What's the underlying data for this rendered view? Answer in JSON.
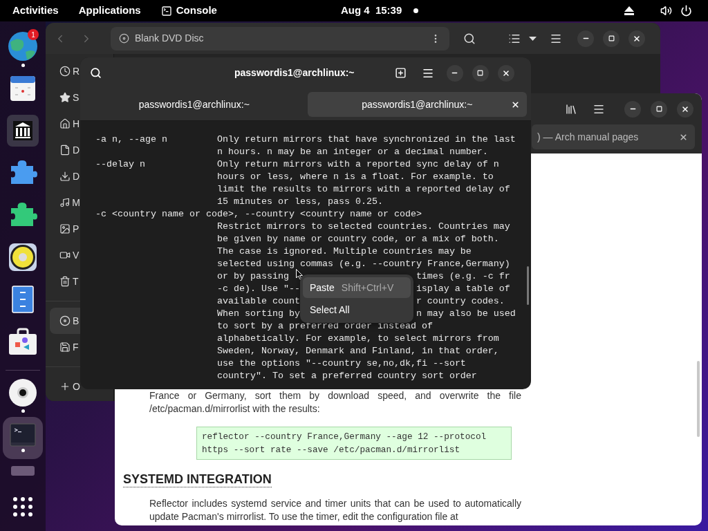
{
  "top_bar": {
    "activities": "Activities",
    "applications": "Applications",
    "app_menu": "Console",
    "clock": "Aug 4  15:39"
  },
  "dock": {
    "items": [
      {
        "kind": "browser",
        "running": true,
        "selected": false,
        "badge": "1"
      },
      {
        "kind": "calendar",
        "running": false,
        "selected": false
      },
      {
        "kind": "library",
        "running": false,
        "selected": false
      },
      {
        "kind": "puzzle-blue",
        "running": false,
        "selected": false
      },
      {
        "kind": "puzzle-green",
        "running": false,
        "selected": false
      },
      {
        "kind": "speaker",
        "running": false,
        "selected": false
      },
      {
        "kind": "cabinet",
        "running": false,
        "selected": false
      },
      {
        "kind": "store",
        "running": false,
        "selected": false
      },
      {
        "kind": "separator"
      },
      {
        "kind": "disc",
        "running": true,
        "selected": false
      },
      {
        "kind": "terminal",
        "running": true,
        "selected": true
      },
      {
        "kind": "bar",
        "running": false,
        "selected": false
      },
      {
        "kind": "grid",
        "running": false,
        "selected": false
      }
    ]
  },
  "files_window": {
    "location": "Blank DVD Disc",
    "sidebar": [
      {
        "kind": "recent",
        "label": "R",
        "selected": false
      },
      {
        "kind": "starred",
        "label": "S",
        "selected": false
      },
      {
        "kind": "home",
        "label": "H",
        "selected": false
      },
      {
        "kind": "documents",
        "label": "D",
        "selected": false
      },
      {
        "kind": "downloads",
        "label": "D",
        "selected": false
      },
      {
        "kind": "music",
        "label": "M",
        "selected": false
      },
      {
        "kind": "pictures",
        "label": "P",
        "selected": false
      },
      {
        "kind": "videos",
        "label": "V",
        "selected": false
      },
      {
        "kind": "trash",
        "label": "T",
        "selected": false
      },
      {
        "kind": "separator"
      },
      {
        "kind": "disc",
        "label": "B",
        "selected": true
      },
      {
        "kind": "floppy",
        "label": "F",
        "selected": false
      },
      {
        "kind": "separator"
      },
      {
        "kind": "other",
        "label": "O",
        "selected": false
      }
    ]
  },
  "browser_window": {
    "tab_title": ") — Arch manual pages",
    "paragraph_1": "France or Germany, sort them by download speed, and overwrite the file /etc/pacman.d/mirrorlist with the results:",
    "code": [
      "reflector --country France,Germany --age 12 --protocol",
      "https --sort rate --save /etc/pacman.d/mirrorlist"
    ],
    "heading": "SYSTEMD INTEGRATION",
    "paragraph_2": "Reflector includes systemd service and timer units that can be used to automatically update Pacman's mirrorlist. To use the timer, edit the configuration file at"
  },
  "terminal_window": {
    "title": "passwordis1@archlinux:~",
    "tabs": [
      {
        "label": "passwordis1@archlinux:~",
        "selected": false
      },
      {
        "label": "passwordis1@archlinux:~",
        "selected": true
      }
    ],
    "rows": [
      {
        "option": "-a n, --age n",
        "text": [
          "Only return mirrors that have synchronized in the last"
        ]
      },
      {
        "text": [
          "n hours. n may be an integer or a decimal number."
        ]
      },
      {
        "option": "--delay n",
        "text": [
          "Only return mirrors with a reported sync delay of n"
        ]
      },
      {
        "text": [
          "hours or less, where n is a float. For example. to"
        ]
      },
      {
        "text": [
          "limit the results to mirrors with a reported delay of"
        ]
      },
      {
        "text": [
          "15 minutes or less, pass 0.25."
        ]
      },
      {
        "option": "-c <country name or code>, --country <country name or code>",
        "text": []
      },
      {
        "text": [
          "Restrict mirrors to selected countries. Countries may"
        ]
      },
      {
        "text": [
          "be given by name or country code, or a mix of both."
        ]
      },
      {
        "text": [
          "The case is ignored. Multiple countries may be"
        ]
      },
      {
        "text": [
          "selected using commas (e.g. --country France,Germany)"
        ]
      },
      {
        "text": [
          "or by passing",
          "times (e.g. -c fr"
        ]
      },
      {
        "text": [
          "-c de). Use \"--",
          "isplay a table of"
        ]
      },
      {
        "text": [
          "available count",
          "r country codes."
        ]
      },
      {
        "text": [
          "When sorting by",
          "n may also be used"
        ]
      },
      {
        "text": [
          "to sort by a preferred order instead of"
        ]
      },
      {
        "text": [
          "alphabetically. For example, to select mirrors from"
        ]
      },
      {
        "text": [
          "Sweden, Norway, Denmark and Finland, in that order,"
        ]
      },
      {
        "text": [
          "use the options \"--country se,no,dk,fi --sort"
        ]
      },
      {
        "text": [
          "country\". To set a preferred country sort order"
        ]
      }
    ]
  },
  "context_menu": {
    "items": [
      {
        "label": "Paste",
        "shortcut": "Shift+Ctrl+V",
        "selected": true
      },
      {
        "label": "Select All",
        "selected": false
      }
    ]
  }
}
